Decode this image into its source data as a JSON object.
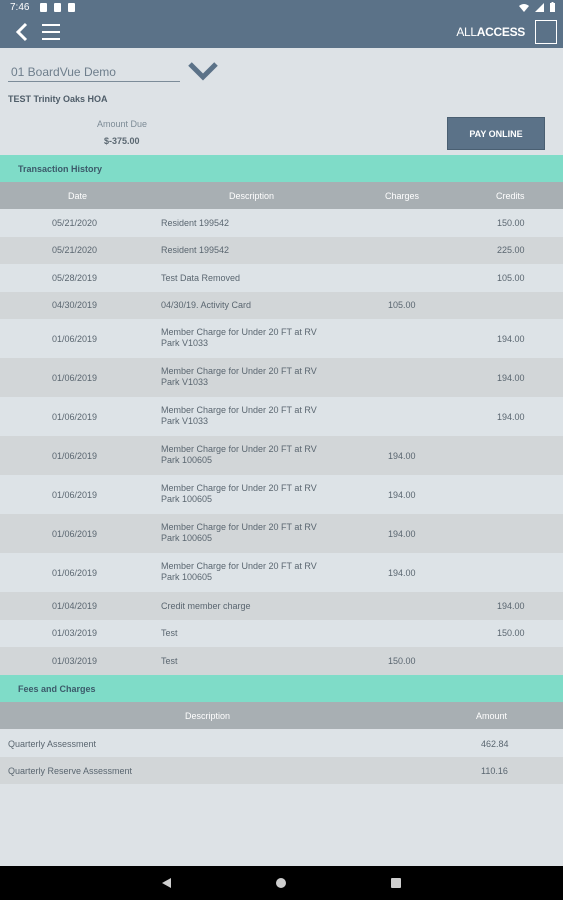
{
  "status": {
    "time": "7:46"
  },
  "header": {
    "brand_thin": "ALL",
    "brand_bold": "ACCESS"
  },
  "association": {
    "selected": "01 BoardVue Demo",
    "name": "TEST Trinity Oaks HOA"
  },
  "amount_due": {
    "label": "Amount Due",
    "value": "$-375.00"
  },
  "pay_button": "PAY ONLINE",
  "transaction_history": {
    "title": "Transaction History",
    "columns": {
      "date": "Date",
      "description": "Description",
      "charges": "Charges",
      "credits": "Credits"
    },
    "rows": [
      {
        "date": "05/21/2020",
        "description": [
          "Resident 199542"
        ],
        "charges": "",
        "credits": "150.00"
      },
      {
        "date": "05/21/2020",
        "description": [
          "Resident 199542"
        ],
        "charges": "",
        "credits": "225.00"
      },
      {
        "date": "05/28/2019",
        "description": [
          "Test Data Removed"
        ],
        "charges": "",
        "credits": "105.00"
      },
      {
        "date": "04/30/2019",
        "description": [
          "04/30/19. Activity Card"
        ],
        "charges": "105.00",
        "credits": ""
      },
      {
        "date": "01/06/2019",
        "description": [
          "Member Charge for Under 20 FT at RV",
          "Park V1033"
        ],
        "charges": "",
        "credits": "194.00"
      },
      {
        "date": "01/06/2019",
        "description": [
          "Member Charge for Under 20 FT at RV",
          "Park V1033"
        ],
        "charges": "",
        "credits": "194.00"
      },
      {
        "date": "01/06/2019",
        "description": [
          "Member Charge for Under 20 FT at RV",
          "Park V1033"
        ],
        "charges": "",
        "credits": "194.00"
      },
      {
        "date": "01/06/2019",
        "description": [
          "Member Charge for Under 20 FT at RV",
          "Park 100605"
        ],
        "charges": "194.00",
        "credits": ""
      },
      {
        "date": "01/06/2019",
        "description": [
          "Member Charge for Under 20 FT at RV",
          "Park 100605"
        ],
        "charges": "194.00",
        "credits": ""
      },
      {
        "date": "01/06/2019",
        "description": [
          "Member Charge for Under 20 FT at RV",
          "Park 100605"
        ],
        "charges": "194.00",
        "credits": ""
      },
      {
        "date": "01/06/2019",
        "description": [
          "Member Charge for Under 20 FT at RV",
          "Park 100605"
        ],
        "charges": "194.00",
        "credits": ""
      },
      {
        "date": "01/04/2019",
        "description": [
          "Credit member charge"
        ],
        "charges": "",
        "credits": "194.00"
      },
      {
        "date": "01/03/2019",
        "description": [
          "Test"
        ],
        "charges": "",
        "credits": "150.00"
      },
      {
        "date": "01/03/2019",
        "description": [
          "Test"
        ],
        "charges": "150.00",
        "credits": ""
      }
    ]
  },
  "fees": {
    "title": "Fees and Charges",
    "columns": {
      "description": "Description",
      "amount": "Amount"
    },
    "rows": [
      {
        "description": "Quarterly Assessment",
        "amount": "462.84"
      },
      {
        "description": "Quarterly Reserve Assessment",
        "amount": "110.16"
      }
    ]
  }
}
